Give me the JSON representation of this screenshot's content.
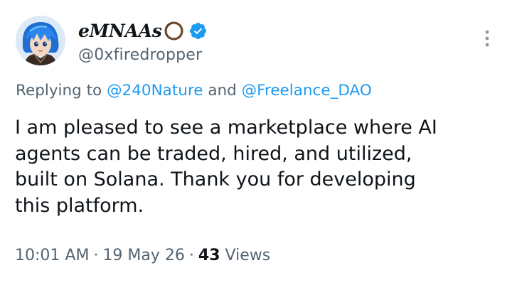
{
  "author": {
    "display_name": "eMNAAs",
    "handle": "@0xfiredropper",
    "name_emoji": "coconut-icon",
    "verified_color": "#1d9bf0"
  },
  "reply": {
    "prefix": "Replying to",
    "mention_1": "@240Nature",
    "conjunction": "and",
    "mention_2": "@Freelance_DAO"
  },
  "body": {
    "lines": [
      "I am pleased to see a marketplace where AI",
      "agents can be traded, hired, and utilized,",
      "built on Solana. Thank you for developing",
      "this platform."
    ]
  },
  "meta": {
    "time": "10:01 AM",
    "date": "19 May 26",
    "separator": "·",
    "views_count": "43",
    "views_label": "Views"
  },
  "colors": {
    "link": "#1d9bf0",
    "secondary_text": "#536471",
    "primary_text": "#0f1419"
  }
}
